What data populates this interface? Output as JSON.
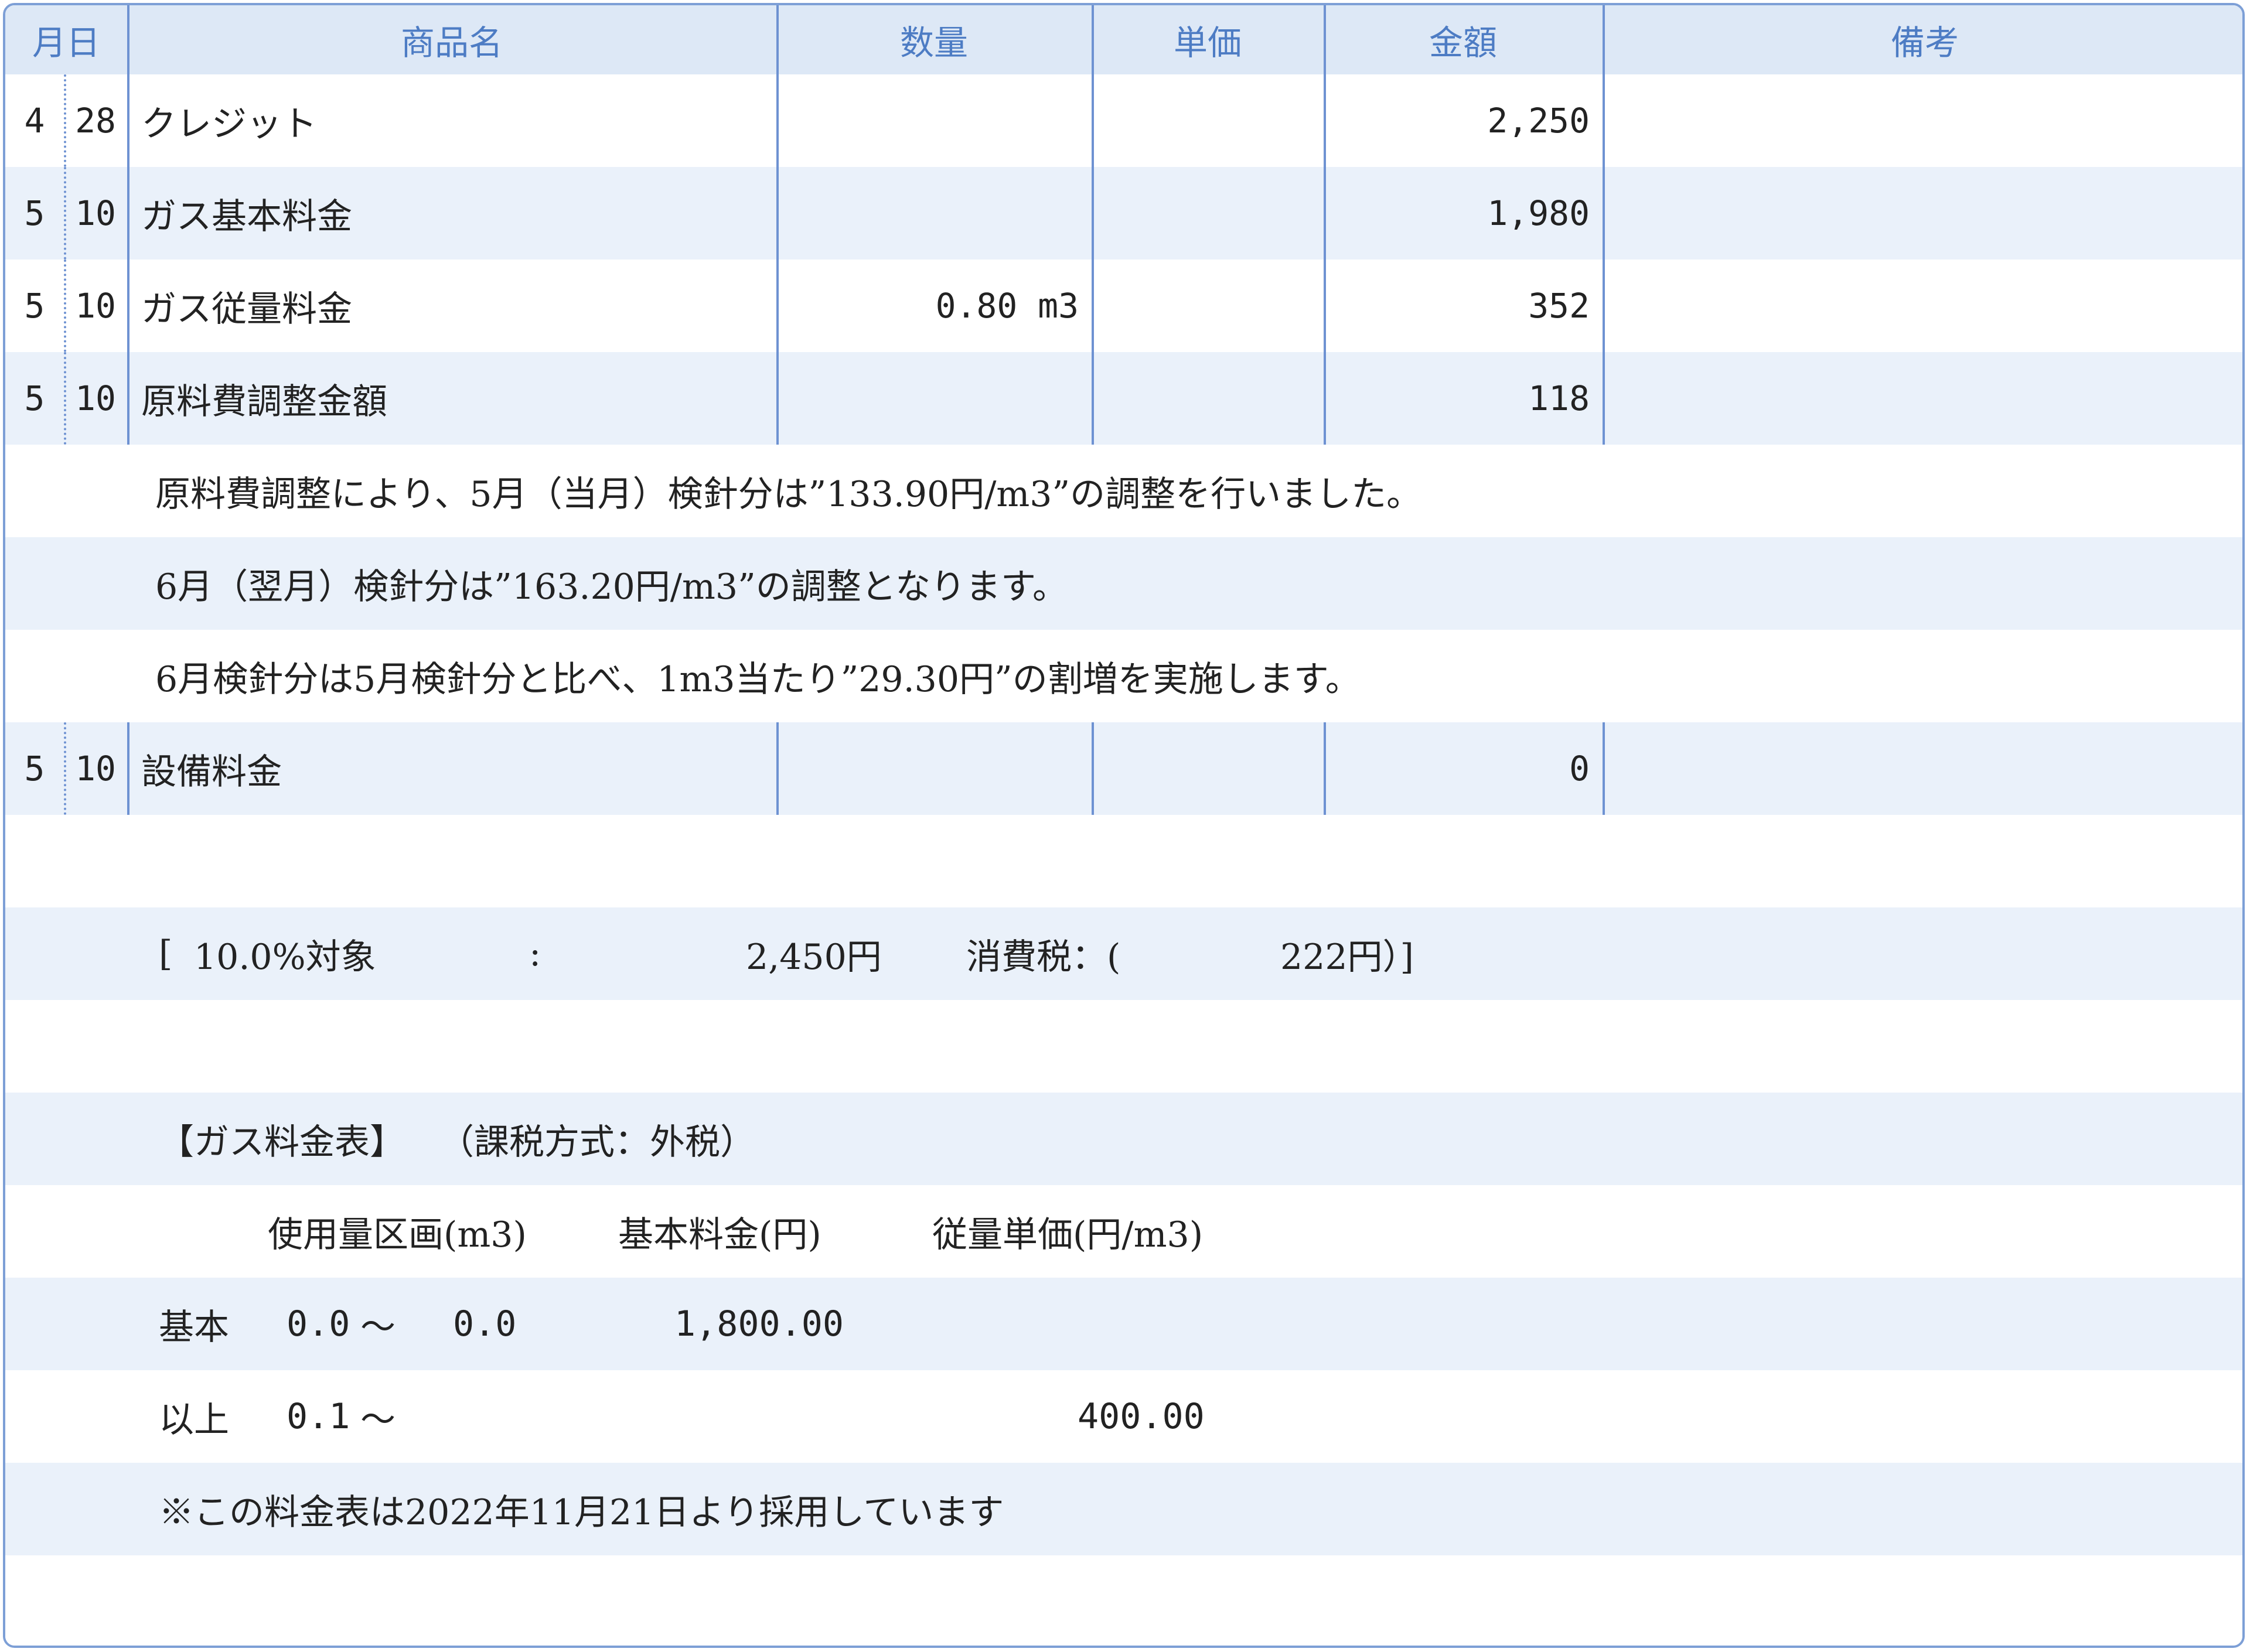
{
  "header": {
    "month_day": "月日",
    "product": "商品名",
    "quantity": "数量",
    "unit_price": "単価",
    "amount": "金額",
    "remarks": "備考"
  },
  "items": [
    {
      "month": "4",
      "day": "28",
      "name": "クレジット",
      "quantity": "",
      "unit_price": "",
      "amount": "2,250",
      "remarks": ""
    },
    {
      "month": "5",
      "day": "10",
      "name": "ガス基本料金",
      "quantity": "",
      "unit_price": "",
      "amount": "1,980",
      "remarks": ""
    },
    {
      "month": "5",
      "day": "10",
      "name": "ガス従量料金",
      "quantity": "0.80 m3",
      "unit_price": "",
      "amount": "352",
      "remarks": ""
    },
    {
      "month": "5",
      "day": "10",
      "name": "原料費調整金額",
      "quantity": "",
      "unit_price": "",
      "amount": "118",
      "remarks": ""
    }
  ],
  "adjustment_notes": [
    "原料費調整により、5月（当月）検針分は”133.90円/m3”の調整を行いました。",
    "6月（翌月）検針分は”163.20円/m3”の調整となります。",
    "6月検針分は5月検針分と比べ、1m3当たり”29.30円”の割増を実施します。"
  ],
  "equipment": {
    "month": "5",
    "day": "10",
    "name": "設備料金",
    "quantity": "",
    "unit_price": "",
    "amount": "0",
    "remarks": ""
  },
  "tax": {
    "open": "[",
    "label": "10.0%対象",
    "colon": ":",
    "amount": "2,450円",
    "tax_label": "消費税：(",
    "tax_amount": "222円）]"
  },
  "rate_table": {
    "title": "【ガス料金表】",
    "tax_method": "（課税方式：外税）",
    "col_usage": "使用量区画(m3)",
    "col_base": "基本料金(円)",
    "col_unit": "従量単価(円/m3)",
    "rows": [
      {
        "label": "基本",
        "from": "0.0",
        "tilde": "～",
        "to": "0.0",
        "base": "1,800.00",
        "unit": ""
      },
      {
        "label": "以上",
        "from": "0.1",
        "tilde": "～",
        "to": "",
        "base": "",
        "unit": "400.00"
      }
    ],
    "footnote": "※この料金表は2022年11月21日より採用しています"
  }
}
